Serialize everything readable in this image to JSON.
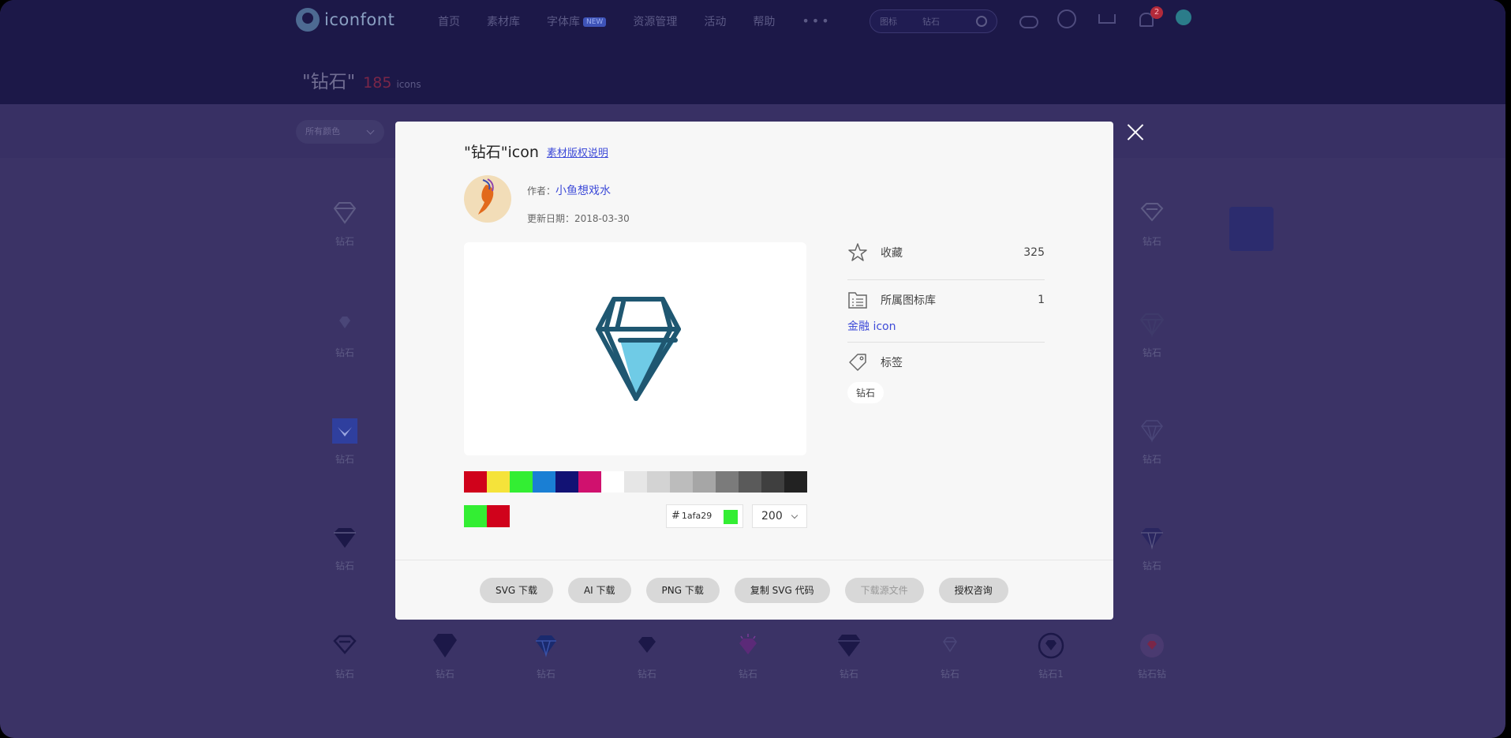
{
  "header": {
    "logo_text": "iconfont",
    "nav": [
      {
        "label": "首页"
      },
      {
        "label": "素材库"
      },
      {
        "label": "字体库",
        "badge": "NEW"
      },
      {
        "label": "资源管理"
      },
      {
        "label": "活动"
      },
      {
        "label": "帮助"
      }
    ],
    "more": "•••",
    "search_type": "图标",
    "search_query": "钻石",
    "notification_count": "2"
  },
  "results": {
    "query_quoted": "\"钻石\"",
    "count": "185",
    "unit": "icons",
    "color_filter": "所有颜色"
  },
  "grid": {
    "left_col": [
      "钻石",
      "钻石",
      "钻石",
      "钻石"
    ],
    "right_col": [
      "钻石",
      "钻石",
      "钻石",
      "钻石"
    ],
    "bottom_row": [
      "钻石",
      "钻石",
      "钻石",
      "钻石",
      "钻石",
      "钻石",
      "钻石",
      "钻石1",
      "钻石钻"
    ]
  },
  "modal": {
    "title": "\"钻石\"icon",
    "license_link": "素材版权说明",
    "author_label": "作者：",
    "author_name": "小鱼想戏水",
    "updated_label": "更新日期：",
    "updated_date": "2018-03-30",
    "palette": [
      "#d0021b",
      "#f5e33a",
      "#33ee33",
      "#1a7fd4",
      "#121274",
      "#d0116e",
      "#ffffff",
      "#e6e6e6",
      "#d3d3d3",
      "#bcbcbc",
      "#a6a6a6",
      "#7b7b7b",
      "#5a5a5a",
      "#3f3f3f",
      "#222222"
    ],
    "selected_colors": [
      "#33ee33",
      "#d0021b"
    ],
    "hash": "#",
    "hex_value": "1afa29",
    "size_value": "200",
    "collect_label": "收藏",
    "collect_count": "325",
    "library_label": "所属图标库",
    "library_count": "1",
    "library_name": "金融 icon",
    "tags_label": "标签",
    "tags": [
      "钻石"
    ],
    "buttons": [
      {
        "label": "SVG 下载",
        "disabled": false
      },
      {
        "label": "AI 下载",
        "disabled": false
      },
      {
        "label": "PNG 下载",
        "disabled": false
      },
      {
        "label": "复制 SVG 代码",
        "disabled": false
      },
      {
        "label": "下载源文件",
        "disabled": true
      },
      {
        "label": "授权咨询",
        "disabled": false
      }
    ],
    "icon_colors": {
      "stroke": "#1f5771",
      "fill": "#6fcbe6"
    }
  }
}
